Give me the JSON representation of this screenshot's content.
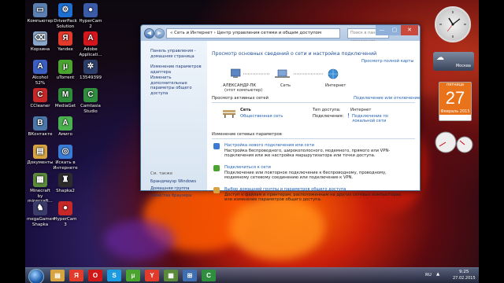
{
  "desktop": {
    "icons": [
      {
        "label": "Компьютер",
        "icon": "computer-icon",
        "color": "#5a7fb0",
        "glyph": "▭"
      },
      {
        "label": "DriverPack Solution",
        "icon": "driverpack-icon",
        "color": "#1d6fd0",
        "glyph": "⚙"
      },
      {
        "label": "HyperCam 2",
        "icon": "hypercam-icon",
        "color": "#3a5ba8",
        "glyph": "●"
      },
      {
        "label": "Корзина",
        "icon": "recycle-bin-icon",
        "color": "#8aa6c8",
        "glyph": "⌫"
      },
      {
        "label": "Yandex",
        "icon": "yandex-icon",
        "color": "#e23b2c",
        "glyph": "Я"
      },
      {
        "label": "Adobe Applicati...",
        "icon": "adobe-icon",
        "color": "#d4161c",
        "glyph": "A"
      },
      {
        "label": "Alcohol 52%",
        "icon": "alcohol-icon",
        "color": "#3b5fc0",
        "glyph": "A"
      },
      {
        "label": "uTorrent",
        "icon": "utorrent-icon",
        "color": "#4aa52e",
        "glyph": "μ"
      },
      {
        "label": "13549399",
        "icon": "image-file-icon",
        "color": "#2c3e6a",
        "glyph": "✲"
      },
      {
        "label": "CCleaner",
        "icon": "ccleaner-icon",
        "color": "#c62828",
        "glyph": "C"
      },
      {
        "label": "MediaGet",
        "icon": "mediaget-icon",
        "color": "#2e8b3a",
        "glyph": "M"
      },
      {
        "label": "Camtasia Studio",
        "icon": "camtasia-icon",
        "color": "#2f8f3f",
        "glyph": "C"
      },
      {
        "label": "ВКонтакте",
        "icon": "vkontakte-icon",
        "color": "#4a76a8",
        "glyph": "В"
      },
      {
        "label": "Амиго",
        "icon": "amigo-icon",
        "color": "#4bb04f",
        "glyph": "A"
      },
      {
        "label": "",
        "icon": "empty-slot-icon",
        "color": "",
        "glyph": ""
      },
      {
        "label": "Документы",
        "icon": "documents-icon",
        "color": "#d8a441",
        "glyph": "▤"
      },
      {
        "label": "Искать в Интернете",
        "icon": "internet-search-icon",
        "color": "#3a7bd5",
        "glyph": "◎"
      },
      {
        "label": "",
        "icon": "empty-slot-icon",
        "color": "",
        "glyph": ""
      },
      {
        "label": "Minecraft by minecraft...",
        "icon": "minecraft-icon",
        "color": "#5b8a3a",
        "glyph": "▦"
      },
      {
        "label": "Shapka2",
        "icon": "shapka-icon",
        "color": "#2c2c2c",
        "glyph": "♜"
      },
      {
        "label": "",
        "icon": "empty-slot-icon",
        "color": "",
        "glyph": ""
      },
      {
        "label": "megaGame# Shapka",
        "icon": "megagame-icon",
        "color": "#3b3b6a",
        "glyph": "♞"
      },
      {
        "label": "HyperCam 3",
        "icon": "hypercam3-icon",
        "color": "#c62828",
        "glyph": "●"
      }
    ]
  },
  "window": {
    "address": "« Сеть и Интернет › Центр управления сетями и общим доступом",
    "search_placeholder": "Поиск в панели управления",
    "left_pane": {
      "links": [
        "Панель управления - домашняя страница",
        "Изменение параметров адаптера",
        "Изменить дополнительные параметры общего доступа"
      ],
      "see_also_title": "См. также",
      "see_also": [
        "Брандмауэр Windows",
        "Домашняя группа",
        "Свойства браузера"
      ]
    },
    "main": {
      "heading": "Просмотр основных сведений о сети и настройка подключений",
      "full_map": "Просмотр полной карты",
      "map_nodes": [
        {
          "label": "АЛЕКСАНДР-ПК",
          "sub": "(этот компьютер)"
        },
        {
          "label": "Сеть",
          "sub": ""
        },
        {
          "label": "Интернет",
          "sub": ""
        }
      ],
      "active_title": "Просмотр активных сетей",
      "connect_link": "Подключение или отключение",
      "network_name": "Сеть",
      "network_type": "Общественная сеть",
      "access_type_label": "Тип доступа:",
      "access_type_value": "Интернет",
      "connections_label": "Подключения:",
      "connections_value": "Подключение по локальной сети",
      "change_title": "Изменение сетевых параметров",
      "tasks": [
        {
          "icon": "new-connection-icon",
          "title": "Настройка нового подключения или сети",
          "desc": "Настройка беспроводного, широкополосного, модемного, прямого или VPN-подключения или же настройка маршрутизатора или точки доступа."
        },
        {
          "icon": "connect-network-icon",
          "title": "Подключиться к сети",
          "desc": "Подключение или повторное подключение к беспроводному, проводному, модемному сетевому соединению или подключение к VPN."
        },
        {
          "icon": "homegroup-icon",
          "title": "Выбор домашней группы и параметров общего доступа",
          "desc": "Доступ к файлам и принтерам, расположенным на других сетевых компьютерах, или изменение параметров общего доступа."
        }
      ]
    }
  },
  "gadgets": {
    "weather_city": "Москва",
    "calendar_weekday": "пятница",
    "calendar_day": "27",
    "calendar_month": "Февраль 2015"
  },
  "taskbar": {
    "apps": [
      {
        "icon": "windows-explorer-icon",
        "color": "#d8a441",
        "glyph": "▤"
      },
      {
        "icon": "yandex-taskbar-icon",
        "color": "#e23b2c",
        "glyph": "Я"
      },
      {
        "icon": "opera-icon",
        "color": "#d01818",
        "glyph": "O"
      },
      {
        "icon": "skype-icon",
        "color": "#1d9be0",
        "glyph": "S"
      },
      {
        "icon": "utorrent-taskbar-icon",
        "color": "#4aa52e",
        "glyph": "μ"
      },
      {
        "icon": "yandex-browser-icon",
        "color": "#e23b2c",
        "glyph": "Y"
      },
      {
        "icon": "minecraft-taskbar-icon",
        "color": "#5b8a3a",
        "glyph": "▦"
      },
      {
        "icon": "network-center-taskbar-icon",
        "color": "#3f6fb0",
        "glyph": "⊞"
      },
      {
        "icon": "camtasia-taskbar-icon",
        "color": "#2f8f3f",
        "glyph": "C"
      }
    ],
    "lang": "RU",
    "time": "9:25",
    "date": "27.02.2015"
  }
}
